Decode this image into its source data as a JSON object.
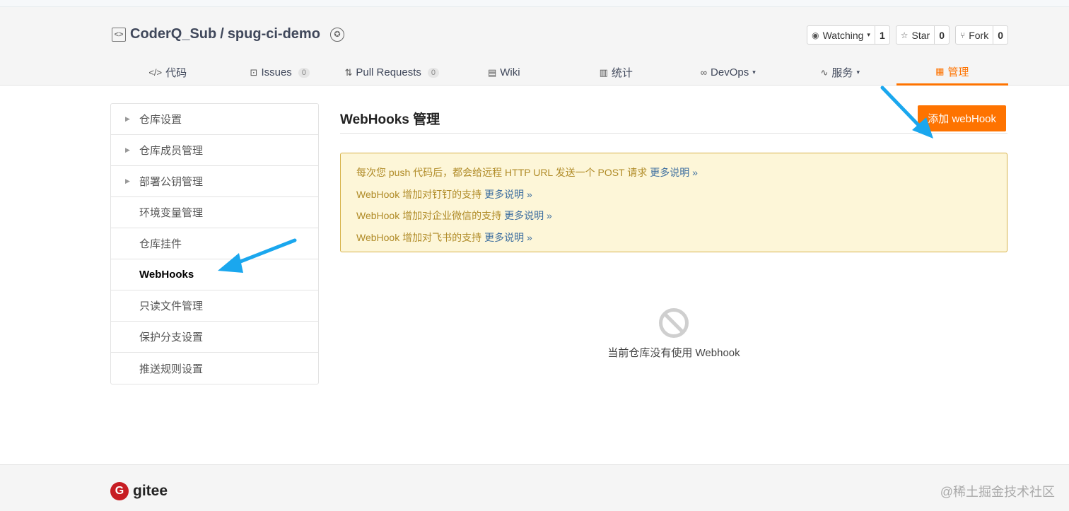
{
  "repo": {
    "owner": "CoderQ_Sub",
    "separator": "/",
    "name": "spug-ci-demo"
  },
  "actions": [
    {
      "label": "Watching",
      "count": "1",
      "icon": "eye-icon",
      "glyph": "◉",
      "caret": "▾"
    },
    {
      "label": "Star",
      "count": "0",
      "icon": "star-icon",
      "glyph": "☆",
      "caret": ""
    },
    {
      "label": "Fork",
      "count": "0",
      "icon": "fork-icon",
      "glyph": "⑂",
      "caret": ""
    }
  ],
  "tabs": [
    {
      "label": "代码",
      "icon": "code-icon",
      "glyph": "</>",
      "num": "",
      "caret": ""
    },
    {
      "label": "Issues",
      "icon": "issues-icon",
      "glyph": "⊡",
      "num": "0",
      "caret": ""
    },
    {
      "label": "Pull Requests",
      "icon": "pull-request-icon",
      "glyph": "⇅",
      "num": "0",
      "caret": ""
    },
    {
      "label": "Wiki",
      "icon": "wiki-icon",
      "glyph": "▤",
      "num": "",
      "caret": ""
    },
    {
      "label": "统计",
      "icon": "stats-icon",
      "glyph": "▥",
      "num": "",
      "caret": ""
    },
    {
      "label": "DevOps",
      "icon": "devops-icon",
      "glyph": "∞",
      "num": "",
      "caret": "▾"
    },
    {
      "label": "服务",
      "icon": "service-icon",
      "glyph": "∿",
      "num": "",
      "caret": "▾"
    },
    {
      "label": "管理",
      "icon": "manage-icon",
      "glyph": "▦",
      "num": "",
      "caret": "",
      "active": true
    }
  ],
  "sidebar": [
    {
      "label": "仓库设置",
      "expandable": true
    },
    {
      "label": "仓库成员管理",
      "expandable": true
    },
    {
      "label": "部署公钥管理",
      "expandable": true
    },
    {
      "label": "环境变量管理",
      "expandable": false
    },
    {
      "label": "仓库挂件",
      "expandable": false
    },
    {
      "label": "WebHooks",
      "expandable": false,
      "active": true
    },
    {
      "label": "只读文件管理",
      "expandable": false
    },
    {
      "label": "保护分支设置",
      "expandable": false
    },
    {
      "label": "推送规则设置",
      "expandable": false
    }
  ],
  "main": {
    "title": "WebHooks 管理",
    "add_button": "添加 webHook",
    "notices": [
      {
        "text": "每次您 push 代码后，都会给远程 HTTP URL 发送一个 POST 请求",
        "more": "更多说明 »"
      },
      {
        "text": "WebHook 增加对钉钉的支持",
        "more": "更多说明 »"
      },
      {
        "text": "WebHook 增加对企业微信的支持",
        "more": "更多说明 »"
      },
      {
        "text": "WebHook 增加对飞书的支持",
        "more": "更多说明 »"
      }
    ],
    "empty_text": "当前仓库没有使用 Webhook"
  },
  "footer": {
    "brand": "gitee",
    "logo_letter": "G",
    "watermark": "@稀土掘金技术社区"
  },
  "colors": {
    "accent": "#fe7300",
    "annotation_arrow": "#1aa7ee",
    "notice_border": "#d6b24a",
    "notice_bg": "#fdf6d8"
  }
}
